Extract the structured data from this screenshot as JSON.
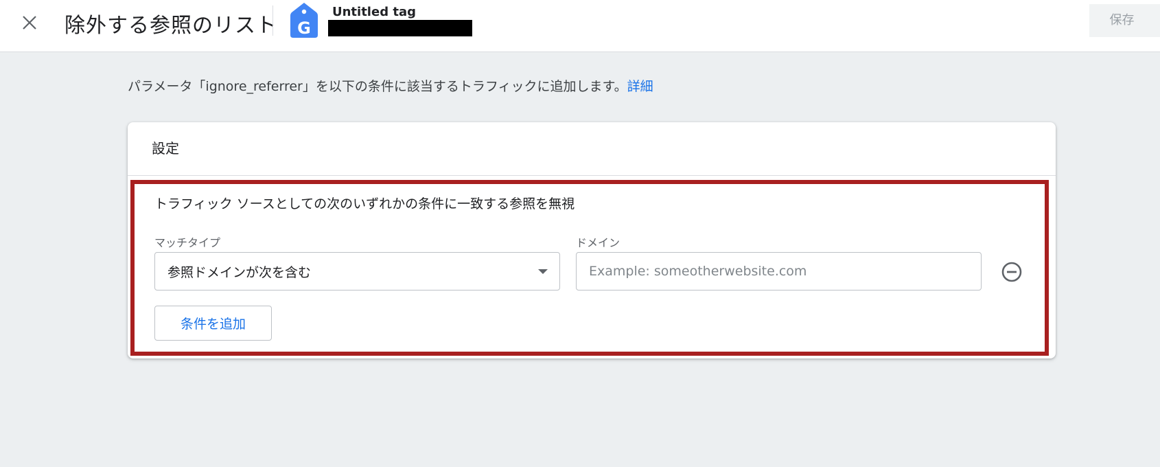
{
  "header": {
    "title": "除外する参照のリスト",
    "tag_name": "Untitled tag",
    "save_label": "保存",
    "close_icon": "close-icon",
    "tag_icon": "google-tag-icon",
    "tag_icon_letter": "G"
  },
  "description": {
    "text": "パラメータ「ignore_referrer」を以下の条件に該当するトラフィックに追加します。",
    "link_label": "詳細"
  },
  "settings_card": {
    "title": "設定",
    "rule_title": "トラフィック ソースとしての次のいずれかの条件に一致する参照を無視",
    "match_type": {
      "label": "マッチタイプ",
      "selected_value": "参照ドメインが次を含む"
    },
    "domain": {
      "label": "ドメイン",
      "value": "",
      "placeholder": "Example: someotherwebsite.com"
    },
    "add_condition_label": "条件を追加"
  },
  "colors": {
    "accent": "#1a73e8",
    "highlight_border": "#a82020",
    "background": "#eceff1",
    "tag_icon": "#4285f4"
  }
}
